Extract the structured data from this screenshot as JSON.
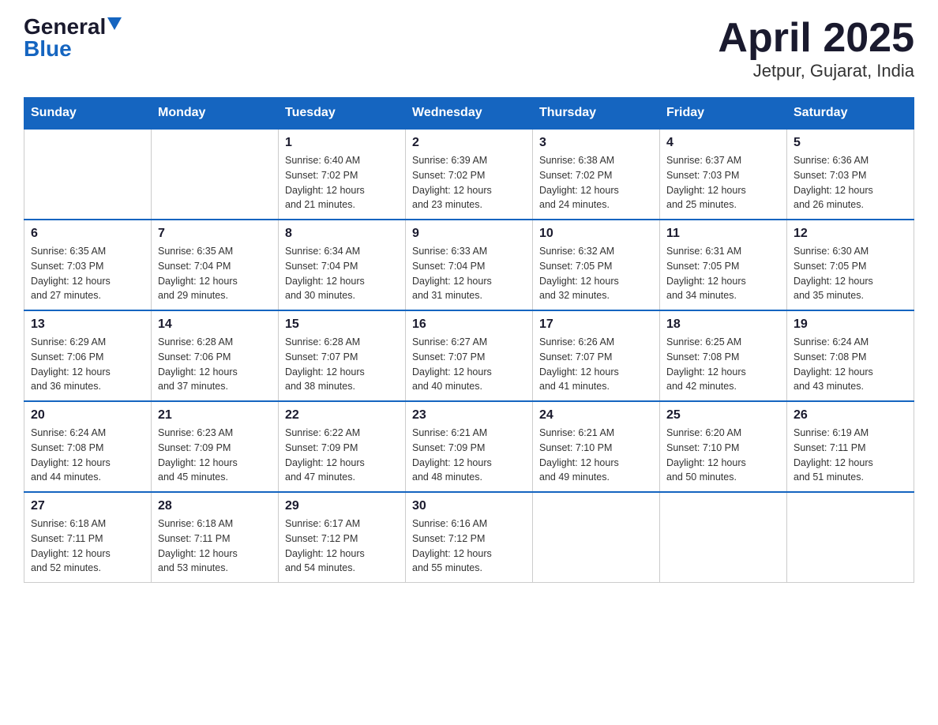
{
  "logo": {
    "general_text": "General",
    "blue_text": "Blue"
  },
  "title": "April 2025",
  "subtitle": "Jetpur, Gujarat, India",
  "days_of_week": [
    "Sunday",
    "Monday",
    "Tuesday",
    "Wednesday",
    "Thursday",
    "Friday",
    "Saturday"
  ],
  "weeks": [
    [
      {
        "day": "",
        "info": ""
      },
      {
        "day": "",
        "info": ""
      },
      {
        "day": "1",
        "info": "Sunrise: 6:40 AM\nSunset: 7:02 PM\nDaylight: 12 hours\nand 21 minutes."
      },
      {
        "day": "2",
        "info": "Sunrise: 6:39 AM\nSunset: 7:02 PM\nDaylight: 12 hours\nand 23 minutes."
      },
      {
        "day": "3",
        "info": "Sunrise: 6:38 AM\nSunset: 7:02 PM\nDaylight: 12 hours\nand 24 minutes."
      },
      {
        "day": "4",
        "info": "Sunrise: 6:37 AM\nSunset: 7:03 PM\nDaylight: 12 hours\nand 25 minutes."
      },
      {
        "day": "5",
        "info": "Sunrise: 6:36 AM\nSunset: 7:03 PM\nDaylight: 12 hours\nand 26 minutes."
      }
    ],
    [
      {
        "day": "6",
        "info": "Sunrise: 6:35 AM\nSunset: 7:03 PM\nDaylight: 12 hours\nand 27 minutes."
      },
      {
        "day": "7",
        "info": "Sunrise: 6:35 AM\nSunset: 7:04 PM\nDaylight: 12 hours\nand 29 minutes."
      },
      {
        "day": "8",
        "info": "Sunrise: 6:34 AM\nSunset: 7:04 PM\nDaylight: 12 hours\nand 30 minutes."
      },
      {
        "day": "9",
        "info": "Sunrise: 6:33 AM\nSunset: 7:04 PM\nDaylight: 12 hours\nand 31 minutes."
      },
      {
        "day": "10",
        "info": "Sunrise: 6:32 AM\nSunset: 7:05 PM\nDaylight: 12 hours\nand 32 minutes."
      },
      {
        "day": "11",
        "info": "Sunrise: 6:31 AM\nSunset: 7:05 PM\nDaylight: 12 hours\nand 34 minutes."
      },
      {
        "day": "12",
        "info": "Sunrise: 6:30 AM\nSunset: 7:05 PM\nDaylight: 12 hours\nand 35 minutes."
      }
    ],
    [
      {
        "day": "13",
        "info": "Sunrise: 6:29 AM\nSunset: 7:06 PM\nDaylight: 12 hours\nand 36 minutes."
      },
      {
        "day": "14",
        "info": "Sunrise: 6:28 AM\nSunset: 7:06 PM\nDaylight: 12 hours\nand 37 minutes."
      },
      {
        "day": "15",
        "info": "Sunrise: 6:28 AM\nSunset: 7:07 PM\nDaylight: 12 hours\nand 38 minutes."
      },
      {
        "day": "16",
        "info": "Sunrise: 6:27 AM\nSunset: 7:07 PM\nDaylight: 12 hours\nand 40 minutes."
      },
      {
        "day": "17",
        "info": "Sunrise: 6:26 AM\nSunset: 7:07 PM\nDaylight: 12 hours\nand 41 minutes."
      },
      {
        "day": "18",
        "info": "Sunrise: 6:25 AM\nSunset: 7:08 PM\nDaylight: 12 hours\nand 42 minutes."
      },
      {
        "day": "19",
        "info": "Sunrise: 6:24 AM\nSunset: 7:08 PM\nDaylight: 12 hours\nand 43 minutes."
      }
    ],
    [
      {
        "day": "20",
        "info": "Sunrise: 6:24 AM\nSunset: 7:08 PM\nDaylight: 12 hours\nand 44 minutes."
      },
      {
        "day": "21",
        "info": "Sunrise: 6:23 AM\nSunset: 7:09 PM\nDaylight: 12 hours\nand 45 minutes."
      },
      {
        "day": "22",
        "info": "Sunrise: 6:22 AM\nSunset: 7:09 PM\nDaylight: 12 hours\nand 47 minutes."
      },
      {
        "day": "23",
        "info": "Sunrise: 6:21 AM\nSunset: 7:09 PM\nDaylight: 12 hours\nand 48 minutes."
      },
      {
        "day": "24",
        "info": "Sunrise: 6:21 AM\nSunset: 7:10 PM\nDaylight: 12 hours\nand 49 minutes."
      },
      {
        "day": "25",
        "info": "Sunrise: 6:20 AM\nSunset: 7:10 PM\nDaylight: 12 hours\nand 50 minutes."
      },
      {
        "day": "26",
        "info": "Sunrise: 6:19 AM\nSunset: 7:11 PM\nDaylight: 12 hours\nand 51 minutes."
      }
    ],
    [
      {
        "day": "27",
        "info": "Sunrise: 6:18 AM\nSunset: 7:11 PM\nDaylight: 12 hours\nand 52 minutes."
      },
      {
        "day": "28",
        "info": "Sunrise: 6:18 AM\nSunset: 7:11 PM\nDaylight: 12 hours\nand 53 minutes."
      },
      {
        "day": "29",
        "info": "Sunrise: 6:17 AM\nSunset: 7:12 PM\nDaylight: 12 hours\nand 54 minutes."
      },
      {
        "day": "30",
        "info": "Sunrise: 6:16 AM\nSunset: 7:12 PM\nDaylight: 12 hours\nand 55 minutes."
      },
      {
        "day": "",
        "info": ""
      },
      {
        "day": "",
        "info": ""
      },
      {
        "day": "",
        "info": ""
      }
    ]
  ]
}
